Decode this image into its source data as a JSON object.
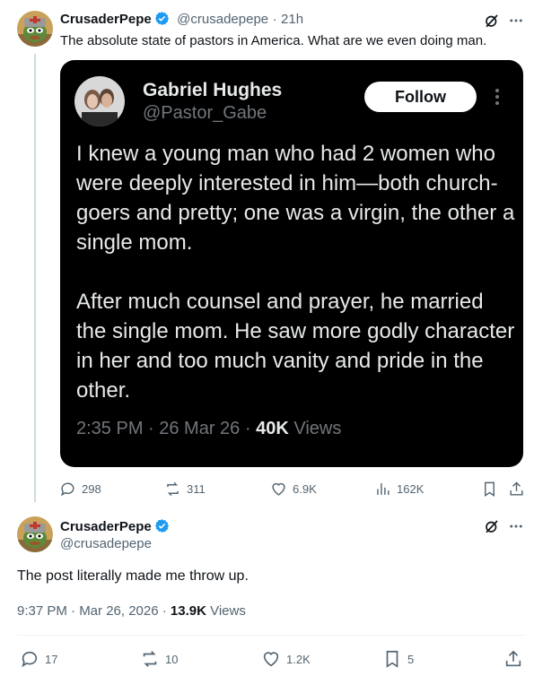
{
  "post": {
    "author_name": "CrusaderPepe",
    "handle": "@crusadepepe",
    "separator": "·",
    "time": "21h",
    "text": "The absolute state of pastors in America. What are we even doing man.",
    "embed": {
      "author_name": "Gabriel Hughes",
      "handle": "@Pastor_Gabe",
      "follow_label": "Follow",
      "paragraph1": "I knew a young man who had 2 women who were deeply interested in him—both church-goers and pretty; one was a virgin, the other a single mom.",
      "paragraph2": "After much counsel and prayer, he married the single mom. He saw more godly character in her and too much vanity and pride in the other.",
      "meta_time": "2:35 PM · 26 Mar 26 · ",
      "meta_views_count": "40K",
      "meta_views_label": " Views"
    },
    "actions": {
      "replies": "298",
      "reposts": "311",
      "likes": "6.9K",
      "views": "162K"
    }
  },
  "reply": {
    "author_name": "CrusaderPepe",
    "handle": "@crusadepepe",
    "text": "The post literally made me throw up.",
    "meta_time": "9:37 PM · Mar 26, 2026 · ",
    "meta_views_count": "13.9K",
    "meta_views_label": " Views",
    "actions": {
      "replies": "17",
      "reposts": "10",
      "likes": "1.2K",
      "bookmarks": "5"
    }
  },
  "colors": {
    "verified": "#1d9bf0",
    "secondary_text": "#536471",
    "embed_bg": "#000000"
  }
}
